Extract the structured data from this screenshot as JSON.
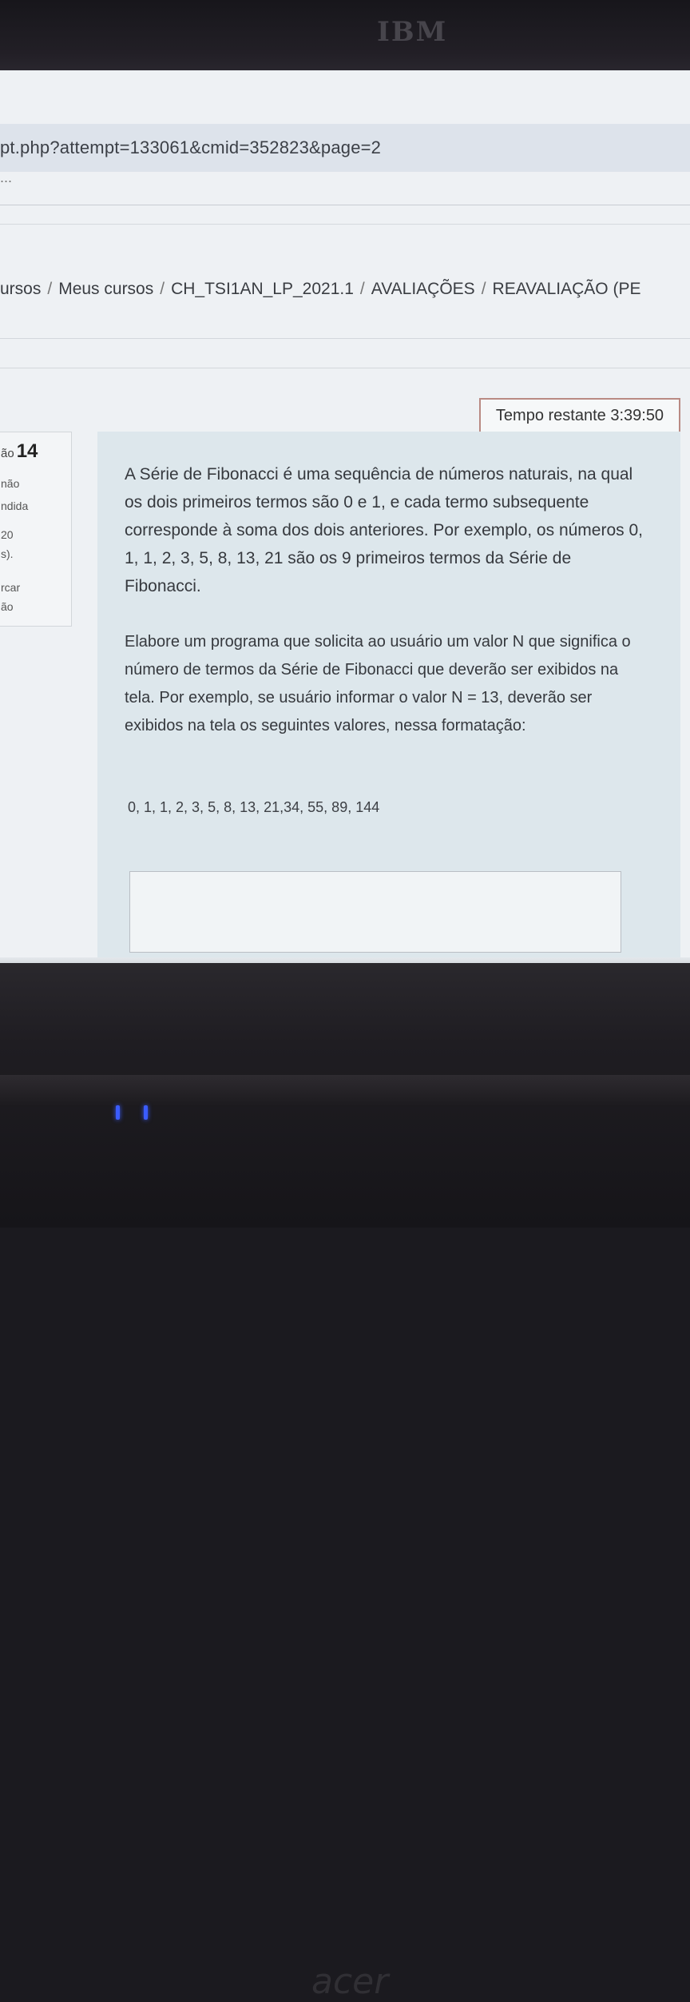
{
  "environment": {
    "top_logo": "IBM",
    "bottom_logo": "acer"
  },
  "browser": {
    "url": "pt.php?attempt=133061&cmid=352823&page=2",
    "menu_ellipsis": "..."
  },
  "breadcrumb": {
    "items": [
      "ursos",
      "Meus cursos",
      "CH_TSI1AN_LP_2021.1",
      "AVALIAÇÕES",
      "REAVALIAÇÃO (PE"
    ],
    "separator": "/"
  },
  "timer": {
    "text": "Tempo restante 3:39:50"
  },
  "question_info": {
    "label": "ão",
    "number": "14",
    "status_1": "não",
    "status_2": "ndida",
    "grade_1": "20",
    "grade_2": "s).",
    "flag_1": "rcar",
    "flag_2": "ão"
  },
  "question": {
    "paragraph_1": "A Série de Fibonacci é uma sequência de números naturais, na qual os dois primeiros termos são 0 e 1, e cada termo subsequente corresponde à soma dos dois anteriores. Por exemplo, os números 0, 1, 1, 2, 3, 5, 8, 13, 21 são os 9 primeiros termos da Série de Fibonacci.",
    "paragraph_2": "Elabore um programa que solicita ao usuário um valor N que significa o número de termos da Série de Fibonacci que deverão ser exibidos na tela. Por exemplo, se usuário informar o valor N = 13, deverão ser exibidos na tela os seguintes valores, nessa formatação:",
    "sequence": "0, 1, 1, 2, 3, 5, 8, 13, 21,34, 55, 89, 144",
    "answer_value": ""
  }
}
